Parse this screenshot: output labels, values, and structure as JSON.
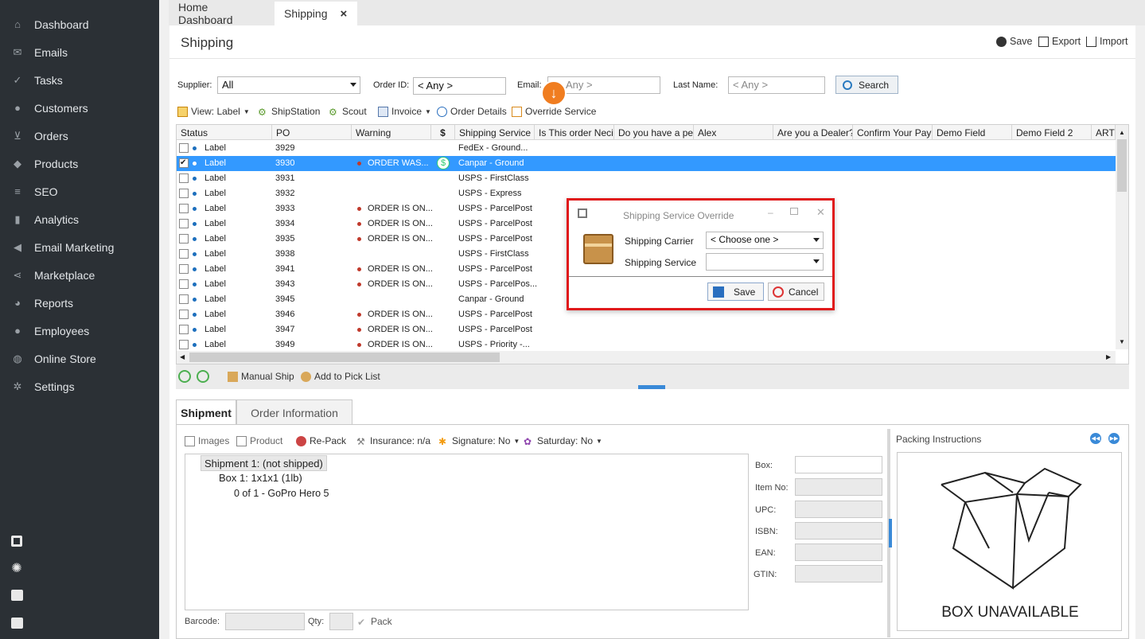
{
  "sidebar": {
    "items": [
      {
        "label": "Dashboard",
        "icon": "home-icon"
      },
      {
        "label": "Emails",
        "icon": "envelope-icon"
      },
      {
        "label": "Tasks",
        "icon": "tasks-icon"
      },
      {
        "label": "Customers",
        "icon": "person-icon"
      },
      {
        "label": "Orders",
        "icon": "cart-icon"
      },
      {
        "label": "Products",
        "icon": "tag-icon"
      },
      {
        "label": "SEO",
        "icon": "sliders-icon"
      },
      {
        "label": "Analytics",
        "icon": "bar-chart-icon"
      },
      {
        "label": "Email Marketing",
        "icon": "megaphone-icon"
      },
      {
        "label": "Marketplace",
        "icon": "share-icon"
      },
      {
        "label": "Reports",
        "icon": "pie-icon"
      },
      {
        "label": "Employees",
        "icon": "people-icon"
      },
      {
        "label": "Online Store",
        "icon": "globe-icon"
      },
      {
        "label": "Settings",
        "icon": "gear-icon"
      }
    ]
  },
  "tabs": [
    {
      "label": "Home Dashboard"
    },
    {
      "label": "Shipping",
      "close": "×"
    }
  ],
  "page": {
    "title": "Shipping",
    "save": "Save",
    "export": "Export",
    "import": "Import"
  },
  "filters": {
    "supplier_label": "Supplier:",
    "supplier_value": "All",
    "order_id_label": "Order ID:",
    "order_id_value": "< Any >",
    "email_label": "Email:",
    "email_value": "Any >",
    "last_name_label": "Last Name:",
    "last_name_value": "< Any >",
    "search": "Search"
  },
  "toolbar": {
    "view": "View: Label",
    "shipstation": "ShipStation",
    "scout": "Scout",
    "invoice": "Invoice",
    "order_details": "Order Details",
    "override_service": "Override Service"
  },
  "grid": {
    "columns": [
      "Status",
      "PO",
      "Warning",
      "$",
      "Shipping Service",
      "Is This order Neci",
      "Do you have a pe",
      "Alex",
      "Are you a Dealer?",
      "Confirm Your Pay",
      "Demo Field",
      "Demo Field 2",
      "ARTH"
    ],
    "rows": [
      {
        "status": "Label",
        "po": "3929",
        "warning": "",
        "service": "FedEx - Ground...",
        "checked": false,
        "selected": false
      },
      {
        "status": "Label",
        "po": "3930",
        "warning": "ORDER WAS...",
        "service": "Canpar - Ground",
        "checked": true,
        "selected": true,
        "dollar": "$"
      },
      {
        "status": "Label",
        "po": "3931",
        "warning": "",
        "service": "USPS - FirstClass",
        "checked": false,
        "selected": false
      },
      {
        "status": "Label",
        "po": "3932",
        "warning": "",
        "service": "USPS - Express",
        "checked": false,
        "selected": false
      },
      {
        "status": "Label",
        "po": "3933",
        "warning": "ORDER IS ON...",
        "service": "USPS - ParcelPost",
        "checked": false,
        "selected": false
      },
      {
        "status": "Label",
        "po": "3934",
        "warning": "ORDER IS ON...",
        "service": "USPS - ParcelPost",
        "checked": false,
        "selected": false
      },
      {
        "status": "Label",
        "po": "3935",
        "warning": "ORDER IS ON...",
        "service": "USPS - ParcelPost",
        "checked": false,
        "selected": false
      },
      {
        "status": "Label",
        "po": "3938",
        "warning": "",
        "service": "USPS - FirstClass",
        "checked": false,
        "selected": false
      },
      {
        "status": "Label",
        "po": "3941",
        "warning": "ORDER IS ON...",
        "service": "USPS - ParcelPost",
        "checked": false,
        "selected": false
      },
      {
        "status": "Label",
        "po": "3943",
        "warning": "ORDER IS ON...",
        "service": "USPS - ParcelPos...",
        "checked": false,
        "selected": false
      },
      {
        "status": "Label",
        "po": "3945",
        "warning": "",
        "service": "Canpar - Ground",
        "checked": false,
        "selected": false
      },
      {
        "status": "Label",
        "po": "3946",
        "warning": "ORDER IS ON...",
        "service": "USPS - ParcelPost",
        "checked": false,
        "selected": false
      },
      {
        "status": "Label",
        "po": "3947",
        "warning": "ORDER IS ON...",
        "service": "USPS - ParcelPost",
        "checked": false,
        "selected": false
      },
      {
        "status": "Label",
        "po": "3949",
        "warning": "ORDER IS ON...",
        "service": "USPS - Priority -...",
        "checked": false,
        "selected": false
      }
    ]
  },
  "bottom_toolbar": {
    "manual_ship": "Manual Ship",
    "add_to_pick_list": "Add to Pick List"
  },
  "dialog": {
    "title": "Shipping Service Override",
    "carrier_label": "Shipping Carrier",
    "carrier_value": "< Choose one >",
    "service_label": "Shipping Service",
    "service_value": "",
    "save": "Save",
    "cancel": "Cancel"
  },
  "lower_tabs": [
    {
      "label": "Shipment"
    },
    {
      "label": "Order Information"
    }
  ],
  "shipment_toolbar": {
    "images": "Images",
    "product": "Product",
    "repack": "Re-Pack",
    "insurance": "Insurance: n/a",
    "signature": "Signature: No",
    "saturday": "Saturday: No"
  },
  "tree": {
    "shipment": "Shipment 1: (not shipped)",
    "box": "Box 1: 1x1x1 (1lb)",
    "item": "0 of 1 - GoPro Hero 5"
  },
  "fields": {
    "box": "Box:",
    "item_no": "Item No:",
    "upc": "UPC:",
    "isbn": "ISBN:",
    "ean": "EAN:",
    "gtin": "GTIN:"
  },
  "footer": {
    "barcode": "Barcode:",
    "qty": "Qty:",
    "pack": "Pack"
  },
  "packing": {
    "title": "Packing Instructions",
    "image_caption": "BOX UNAVAILABLE"
  },
  "colors": {
    "sidebar": "#2b3035",
    "accent": "#3399ff",
    "dialog_border": "#e0191b",
    "badge": "#f07d20"
  }
}
